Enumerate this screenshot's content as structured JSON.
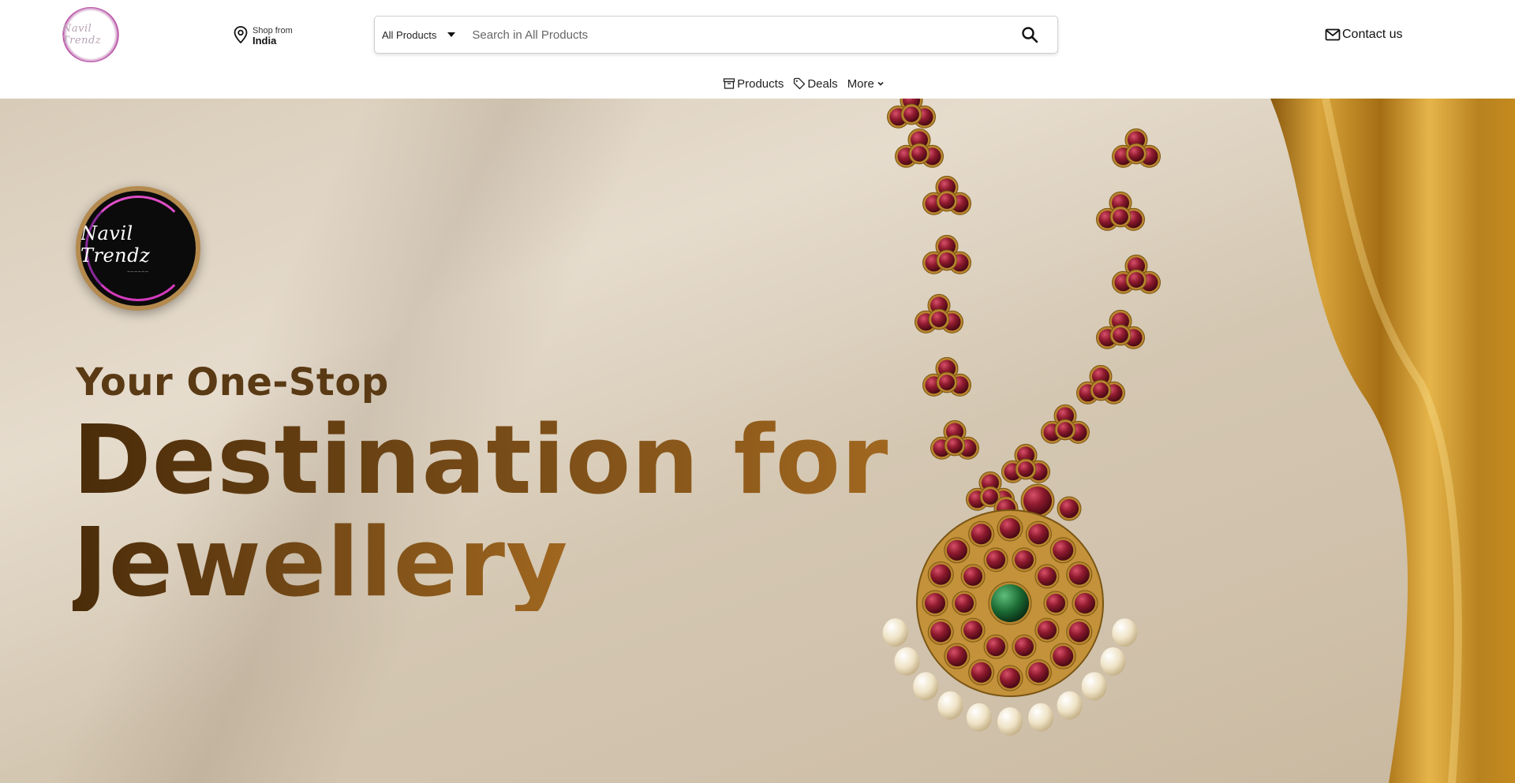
{
  "header": {
    "logo_text": "Navil Trendz",
    "location": {
      "small": "Shop from",
      "big": "India"
    },
    "search": {
      "category": "All Products",
      "placeholder": "Search in All Products"
    },
    "contact_label": "Contact us"
  },
  "nav": {
    "items": [
      {
        "label": "Products",
        "icon": "archive-box-icon"
      },
      {
        "label": "Deals",
        "icon": "tag-icon"
      },
      {
        "label": "More",
        "icon": "chevron-down-icon"
      }
    ]
  },
  "hero": {
    "badge_text": "Navil Trendz",
    "line1": "Your One-Stop",
    "line2": "Destination for",
    "line3": "Jewellery"
  },
  "colors": {
    "hero_text_dark": "#4a2c0a",
    "hero_text_gold": "#a0671f",
    "satin_gold": "#c48a1e",
    "ruby": "#8e1a2e"
  }
}
